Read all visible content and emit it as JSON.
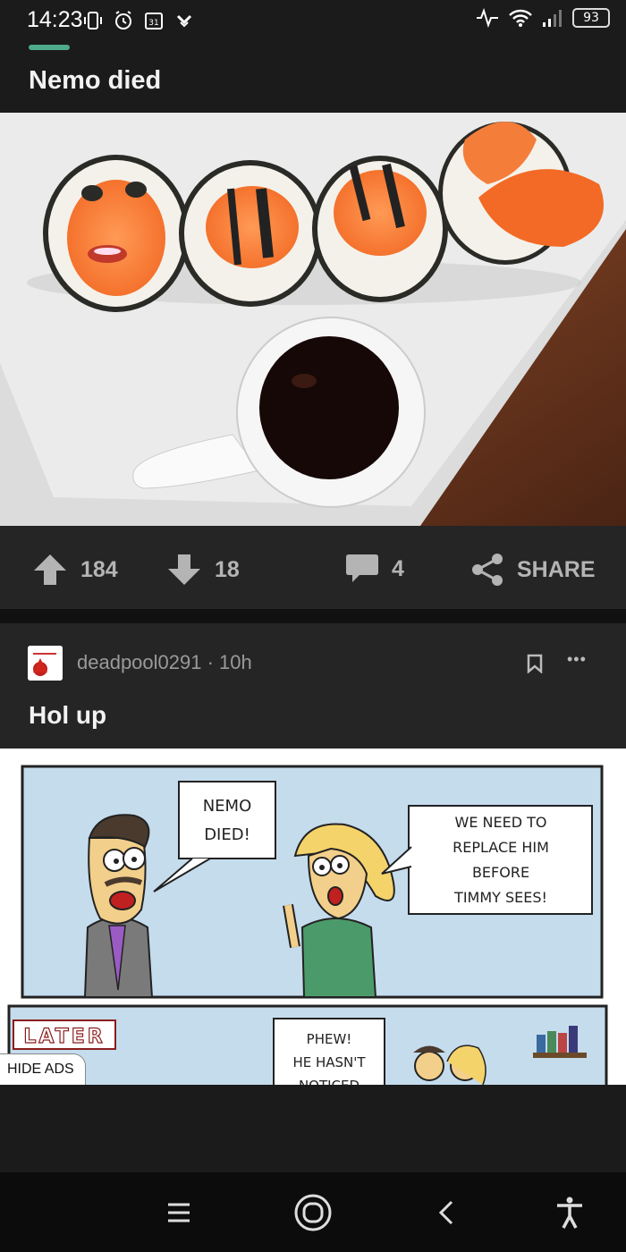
{
  "status_bar": {
    "time": "14:23",
    "battery": "93",
    "icons": [
      "vibrate-icon",
      "alarm-icon",
      "calendar-icon",
      "app-icon",
      "activity-icon",
      "wifi-icon",
      "signal-icon",
      "battery-icon"
    ],
    "calendar_day": "31"
  },
  "post1": {
    "title": "Nemo died",
    "upvotes": "184",
    "downvotes": "18",
    "comments": "4",
    "share_label": "SHARE"
  },
  "post2": {
    "username": "deadpool0291",
    "separator": " · ",
    "age": "10h",
    "title": "Hol up",
    "comic": {
      "bubble_1": [
        "NEMO",
        "DIED!"
      ],
      "bubble_2": [
        "WE NEED TO",
        "REPLACE HIM",
        "BEFORE",
        "TIMMY SEES!"
      ],
      "caption": "LATER",
      "bubble_3": [
        "PHEW!",
        "HE HASN'T",
        "NOTICED"
      ]
    }
  },
  "hide_ads_label": "HIDE ADS",
  "colors": {
    "background": "#1b1b1b",
    "card": "#252525",
    "accent": "#4fa98b",
    "icon_gray": "#b4b4b4"
  }
}
